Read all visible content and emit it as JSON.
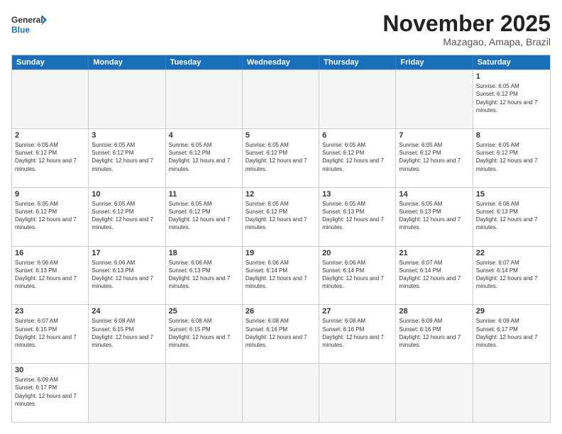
{
  "logo": {
    "text_general": "General",
    "text_blue": "Blue"
  },
  "header": {
    "month": "November 2025",
    "location": "Mazagao, Amapa, Brazil"
  },
  "days_of_week": [
    "Sunday",
    "Monday",
    "Tuesday",
    "Wednesday",
    "Thursday",
    "Friday",
    "Saturday"
  ],
  "rows": [
    [
      {
        "day": "",
        "info": "",
        "empty": true
      },
      {
        "day": "",
        "info": "",
        "empty": true
      },
      {
        "day": "",
        "info": "",
        "empty": true
      },
      {
        "day": "",
        "info": "",
        "empty": true
      },
      {
        "day": "",
        "info": "",
        "empty": true
      },
      {
        "day": "",
        "info": "",
        "empty": true
      },
      {
        "day": "1",
        "info": "Sunrise: 6:05 AM\nSunset: 6:12 PM\nDaylight: 12 hours and 7 minutes."
      }
    ],
    [
      {
        "day": "2",
        "info": "Sunrise: 6:05 AM\nSunset: 6:12 PM\nDaylight: 12 hours and 7 minutes."
      },
      {
        "day": "3",
        "info": "Sunrise: 6:05 AM\nSunset: 6:12 PM\nDaylight: 12 hours and 7 minutes."
      },
      {
        "day": "4",
        "info": "Sunrise: 6:05 AM\nSunset: 6:12 PM\nDaylight: 12 hours and 7 minutes."
      },
      {
        "day": "5",
        "info": "Sunrise: 6:05 AM\nSunset: 6:12 PM\nDaylight: 12 hours and 7 minutes."
      },
      {
        "day": "6",
        "info": "Sunrise: 6:05 AM\nSunset: 6:12 PM\nDaylight: 12 hours and 7 minutes."
      },
      {
        "day": "7",
        "info": "Sunrise: 6:05 AM\nSunset: 6:12 PM\nDaylight: 12 hours and 7 minutes."
      },
      {
        "day": "8",
        "info": "Sunrise: 6:05 AM\nSunset: 6:12 PM\nDaylight: 12 hours and 7 minutes."
      }
    ],
    [
      {
        "day": "9",
        "info": "Sunrise: 6:05 AM\nSunset: 6:12 PM\nDaylight: 12 hours and 7 minutes."
      },
      {
        "day": "10",
        "info": "Sunrise: 6:05 AM\nSunset: 6:12 PM\nDaylight: 12 hours and 7 minutes."
      },
      {
        "day": "11",
        "info": "Sunrise: 6:05 AM\nSunset: 6:12 PM\nDaylight: 12 hours and 7 minutes."
      },
      {
        "day": "12",
        "info": "Sunrise: 6:05 AM\nSunset: 6:12 PM\nDaylight: 12 hours and 7 minutes."
      },
      {
        "day": "13",
        "info": "Sunrise: 6:05 AM\nSunset: 6:13 PM\nDaylight: 12 hours and 7 minutes."
      },
      {
        "day": "14",
        "info": "Sunrise: 6:05 AM\nSunset: 6:13 PM\nDaylight: 12 hours and 7 minutes."
      },
      {
        "day": "15",
        "info": "Sunrise: 6:06 AM\nSunset: 6:13 PM\nDaylight: 12 hours and 7 minutes."
      }
    ],
    [
      {
        "day": "16",
        "info": "Sunrise: 6:06 AM\nSunset: 6:13 PM\nDaylight: 12 hours and 7 minutes."
      },
      {
        "day": "17",
        "info": "Sunrise: 6:06 AM\nSunset: 6:13 PM\nDaylight: 12 hours and 7 minutes."
      },
      {
        "day": "18",
        "info": "Sunrise: 6:06 AM\nSunset: 6:13 PM\nDaylight: 12 hours and 7 minutes."
      },
      {
        "day": "19",
        "info": "Sunrise: 6:06 AM\nSunset: 6:14 PM\nDaylight: 12 hours and 7 minutes."
      },
      {
        "day": "20",
        "info": "Sunrise: 6:06 AM\nSunset: 6:14 PM\nDaylight: 12 hours and 7 minutes."
      },
      {
        "day": "21",
        "info": "Sunrise: 6:07 AM\nSunset: 6:14 PM\nDaylight: 12 hours and 7 minutes."
      },
      {
        "day": "22",
        "info": "Sunrise: 6:07 AM\nSunset: 6:14 PM\nDaylight: 12 hours and 7 minutes."
      }
    ],
    [
      {
        "day": "23",
        "info": "Sunrise: 6:07 AM\nSunset: 6:15 PM\nDaylight: 12 hours and 7 minutes."
      },
      {
        "day": "24",
        "info": "Sunrise: 6:08 AM\nSunset: 6:15 PM\nDaylight: 12 hours and 7 minutes."
      },
      {
        "day": "25",
        "info": "Sunrise: 6:08 AM\nSunset: 6:15 PM\nDaylight: 12 hours and 7 minutes."
      },
      {
        "day": "26",
        "info": "Sunrise: 6:08 AM\nSunset: 6:16 PM\nDaylight: 12 hours and 7 minutes."
      },
      {
        "day": "27",
        "info": "Sunrise: 6:08 AM\nSunset: 6:16 PM\nDaylight: 12 hours and 7 minutes."
      },
      {
        "day": "28",
        "info": "Sunrise: 6:09 AM\nSunset: 6:16 PM\nDaylight: 12 hours and 7 minutes."
      },
      {
        "day": "29",
        "info": "Sunrise: 6:09 AM\nSunset: 6:17 PM\nDaylight: 12 hours and 7 minutes."
      }
    ],
    [
      {
        "day": "30",
        "info": "Sunrise: 6:09 AM\nSunset: 6:17 PM\nDaylight: 12 hours and 7 minutes."
      },
      {
        "day": "",
        "info": "",
        "empty": true
      },
      {
        "day": "",
        "info": "",
        "empty": true
      },
      {
        "day": "",
        "info": "",
        "empty": true
      },
      {
        "day": "",
        "info": "",
        "empty": true
      },
      {
        "day": "",
        "info": "",
        "empty": true
      },
      {
        "day": "",
        "info": "",
        "empty": true
      }
    ]
  ]
}
